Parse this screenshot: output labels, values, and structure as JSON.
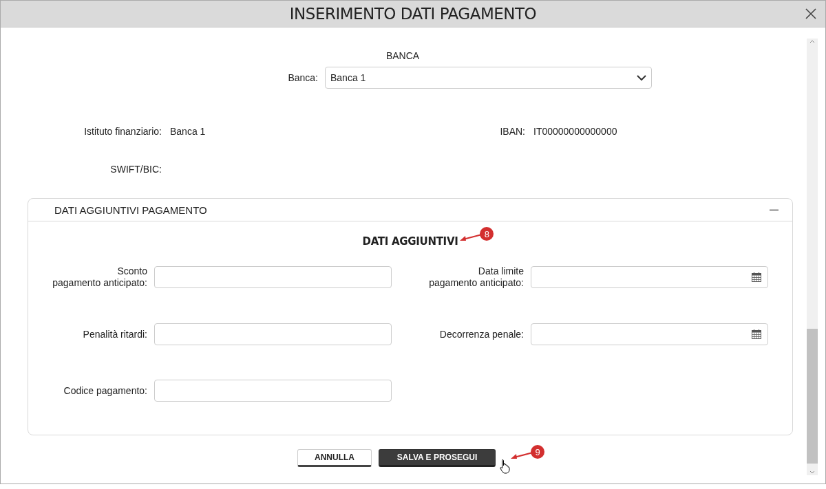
{
  "window": {
    "title": "INSERIMENTO DATI PAGAMENTO"
  },
  "bank_section": {
    "heading": "BANCA",
    "select_label": "Banca:",
    "select_value": "Banca 1"
  },
  "info_fields": [
    {
      "label": "Istituto finanziario:",
      "value": "Banca 1"
    },
    {
      "label": "IBAN:",
      "value": "IT00000000000000"
    },
    {
      "label": "SWIFT/BIC:"
    }
  ],
  "panel": {
    "title": "DATI AGGIUNTIVI PAGAMENTO",
    "expanded": true,
    "heading": "DATI AGGIUNTIVI",
    "annotation": "8",
    "fields": [
      {
        "label": "Sconto\npagamento anticipato:",
        "kind": "text"
      },
      {
        "label": "Data limite\npagamento anticipato:",
        "kind": "date"
      },
      {
        "label": "Penalità ritardi:",
        "kind": "text"
      },
      {
        "label": "Decorrenza penale:",
        "kind": "date"
      },
      {
        "label": "Codice pagamento:",
        "kind": "text"
      }
    ]
  },
  "buttons": [
    {
      "label": "ANNULLA",
      "kind": "secondary"
    },
    {
      "label": "SALVA E PROSEGUI",
      "kind": "primary"
    }
  ],
  "buttons_annotation": "9"
}
